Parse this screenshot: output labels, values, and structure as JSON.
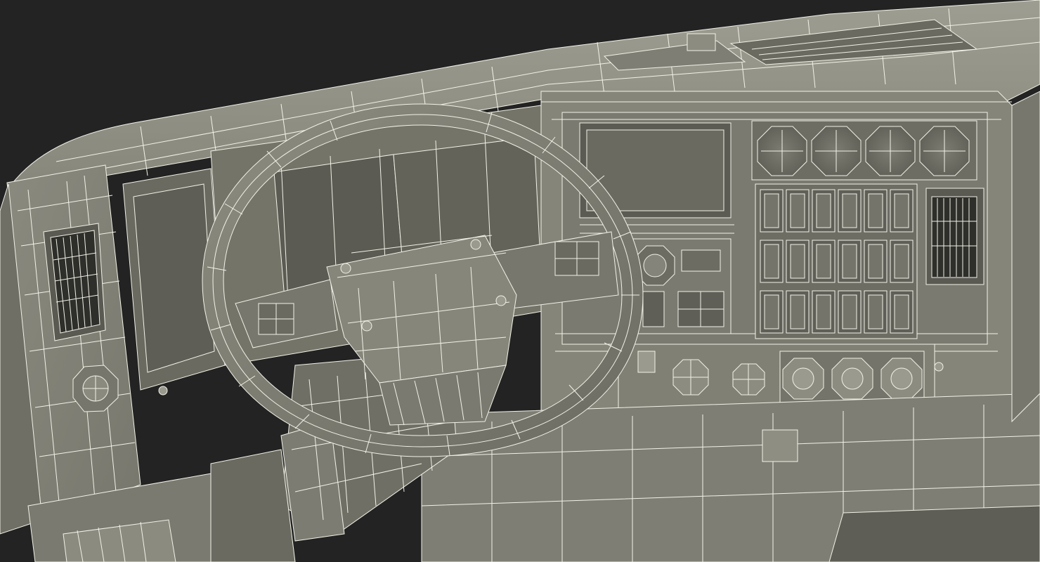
{
  "scene": {
    "subject": "truck-dashboard-wireframe",
    "background_color": "#232323",
    "surface_color": "#8e8e82",
    "surface_shadow_color": "#6f6f65",
    "surface_dark_color": "#55554d",
    "wire_color": "#f2f2e8",
    "recess_color": "#3a3a34",
    "gauge_count": 4,
    "switch_rows": 3,
    "switches_per_row": 6,
    "rotary_knobs_count": 3,
    "air_vents_count": 2
  }
}
